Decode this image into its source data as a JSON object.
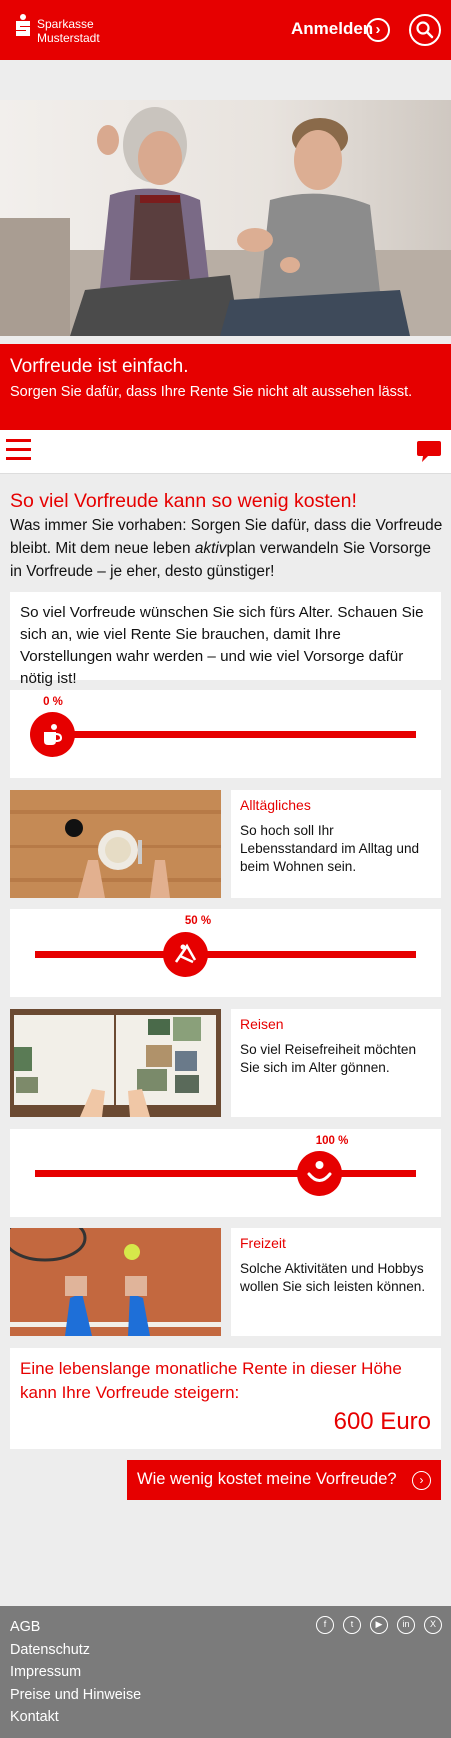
{
  "header": {
    "bank_name_line1": "Sparkasse",
    "bank_name_line2": "Musterstadt",
    "login_label": "Anmelden",
    "login_icon": "›",
    "brand_color": "#e60000"
  },
  "banner": {
    "title": "Vorfreude ist einfach.",
    "subtitle": "Sorgen Sie dafür, dass Ihre Rente Sie nicht alt aussehen lässt."
  },
  "main": {
    "headline": "So viel Vorfreude kann so wenig kosten!",
    "intro_part1": "Was immer Sie vorhaben: Sorgen Sie dafür, dass die Vorfreude bleibt. Mit dem neue leben ",
    "intro_em": "aktiv",
    "intro_part2": "plan verwandeln Sie Vorsorge in Vorfreude – je eher, desto günstiger!",
    "box_text": "So viel Vorfreude wünschen Sie sich fürs Alter. Schauen Sie sich an, wie viel Rente Sie brauchen, damit Ihre Vorstellungen wahr werden – und wie viel Vorsorge dafür nötig ist!"
  },
  "sliders": [
    {
      "value_label": "0 %",
      "value": 0,
      "icon": "cup-icon"
    },
    {
      "value_label": "50 %",
      "value": 50,
      "icon": "deckchair-icon"
    },
    {
      "value_label": "100 %",
      "value": 100,
      "icon": "smiley-icon"
    }
  ],
  "cards": [
    {
      "title": "Alltägliches",
      "desc": "So hoch soll Ihr Lebensstandard im Alltag und beim Wohnen sein."
    },
    {
      "title": "Reisen",
      "desc": "So viel Reisefreiheit möchten Sie sich im Alter gönnen."
    },
    {
      "title": "Freizeit",
      "desc": "Solche Aktivitäten und Hobbys wollen Sie sich leisten können."
    }
  ],
  "result": {
    "title": "Eine lebenslange monatliche Rente in dieser Höhe kann Ihre Vorfreude steigern:",
    "value": "600 Euro"
  },
  "cta": {
    "label": "Wie wenig kostet meine Vorfreude?",
    "icon": "›"
  },
  "footer": {
    "links": [
      "AGB",
      "Datenschutz",
      "Impressum",
      "Preise und Hinweise",
      "Kontakt"
    ],
    "social": [
      {
        "name": "facebook-icon",
        "glyph": "f"
      },
      {
        "name": "twitter-icon",
        "glyph": "t"
      },
      {
        "name": "youtube-icon",
        "glyph": "▶"
      },
      {
        "name": "linkedin-icon",
        "glyph": "in"
      },
      {
        "name": "xing-icon",
        "glyph": "X"
      }
    ]
  }
}
